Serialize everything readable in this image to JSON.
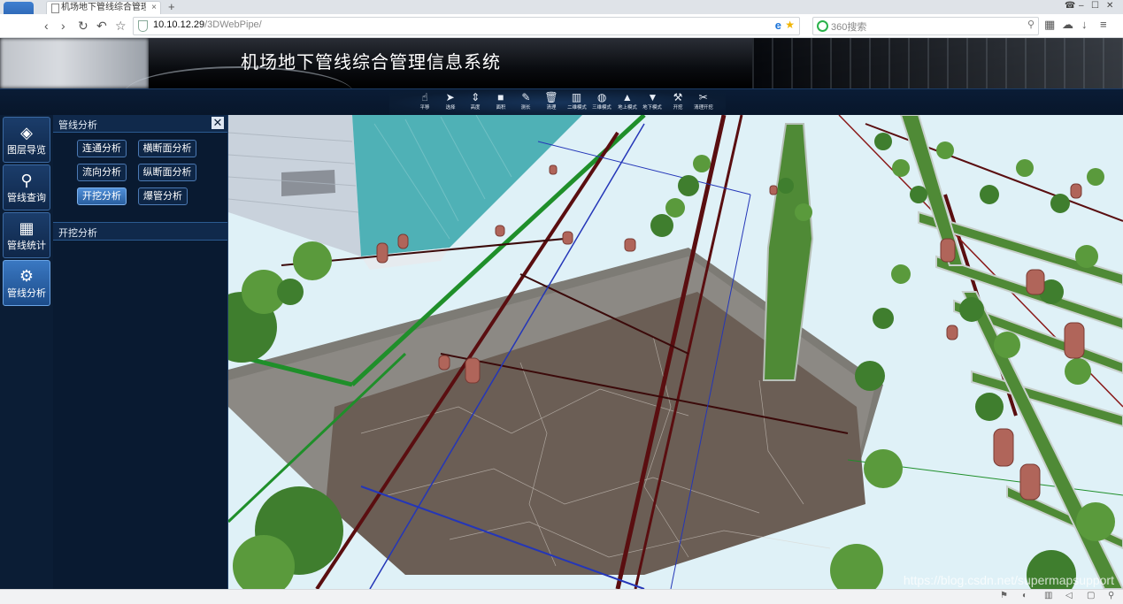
{
  "browser": {
    "tab_title": "机场地下管线综合管理信息系",
    "tab_close": "×",
    "new_tab": "+",
    "url_host": "10.10.12.29",
    "url_path": "/3DWebPipe/",
    "search_placeholder": "360搜索",
    "controls": {
      "pin": "☎",
      "minimize": "–",
      "maximize": "☐",
      "close": "✕"
    },
    "nav": {
      "back": "‹",
      "forward": "›",
      "reload": "↻",
      "undo": "↶",
      "star": "☆"
    },
    "right": {
      "apps": "▦",
      "cloud": "☁",
      "download": "↓",
      "menu": "≡"
    }
  },
  "app": {
    "title": "机场地下管线综合管理信息系统"
  },
  "toolbar": [
    {
      "label": "平移",
      "icon": "hand-icon",
      "glyph": "☝"
    },
    {
      "label": "选择",
      "icon": "pointer-icon",
      "glyph": "➤"
    },
    {
      "label": "高度",
      "icon": "height-icon",
      "glyph": "⇕"
    },
    {
      "label": "面积",
      "icon": "area-icon",
      "glyph": "■"
    },
    {
      "label": "测长",
      "icon": "ruler-icon",
      "glyph": "✎"
    },
    {
      "label": "清理",
      "icon": "trash-icon",
      "glyph": "🗑"
    },
    {
      "label": "二维模式",
      "icon": "map-icon",
      "glyph": "▥"
    },
    {
      "label": "三维模式",
      "icon": "globe-icon",
      "glyph": "◍"
    },
    {
      "label": "地上模式",
      "icon": "above-ground-icon",
      "glyph": "▲"
    },
    {
      "label": "地下模式",
      "icon": "underground-icon",
      "glyph": "▼"
    },
    {
      "label": "开挖",
      "icon": "excavate-icon",
      "glyph": "⚒"
    },
    {
      "label": "清理开挖",
      "icon": "clear-excavate-icon",
      "glyph": "✂"
    }
  ],
  "leftnav": [
    {
      "label": "图层导览",
      "icon": "layers-icon",
      "glyph": "◈",
      "active": false
    },
    {
      "label": "管线查询",
      "icon": "pipe-query-icon",
      "glyph": "⚲",
      "active": false
    },
    {
      "label": "管线统计",
      "icon": "pipe-stats-icon",
      "glyph": "▦",
      "active": false
    },
    {
      "label": "管线分析",
      "icon": "pipe-analysis-icon",
      "glyph": "⚙",
      "active": true
    }
  ],
  "panel": {
    "title": "管线分析",
    "close": "✕",
    "buttons": [
      {
        "label": "连通分析",
        "active": false
      },
      {
        "label": "横断面分析",
        "active": false
      },
      {
        "label": "流向分析",
        "active": false
      },
      {
        "label": "纵断面分析",
        "active": false
      },
      {
        "label": "开挖分析",
        "active": true
      },
      {
        "label": "爆管分析",
        "active": false
      }
    ],
    "sub_title": "开挖分析"
  },
  "watermark": "https://blog.csdn.net/supermapsupport",
  "colors": {
    "sky": "#dff1f7",
    "excavation_floor": "#6b5e55",
    "excavation_wall": "#7d7b75",
    "green_pipe": "#1f8f2a",
    "red_pipe": "#5a0e10",
    "blue_pipe": "#2436b8",
    "grass_strip": "#4f8a36"
  }
}
